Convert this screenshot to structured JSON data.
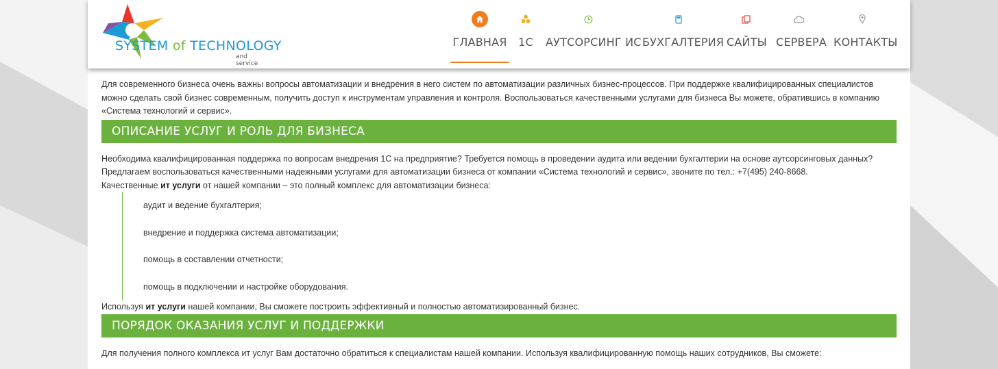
{
  "brand": {
    "logo_main": "SYSTEM",
    "logo_of": "of",
    "logo_tech": "TECHNOLOGY",
    "logo_sub": "and service"
  },
  "nav": {
    "items": [
      {
        "label": "ГЛАВНАЯ",
        "icon": "home-icon",
        "active": true
      },
      {
        "label": "1С",
        "icon": "radiation-icon"
      },
      {
        "label": "АУТСОРСИНГ ИС",
        "icon": "clock-icon"
      },
      {
        "label": "БУХГАЛТЕРИЯ",
        "icon": "calculator-icon"
      },
      {
        "label": "САЙТЫ",
        "icon": "copy-icon"
      },
      {
        "label": "СЕРВЕРА",
        "icon": "cloud-icon"
      },
      {
        "label": "КОНТАКТЫ",
        "icon": "map-pin-icon"
      }
    ],
    "accent": "#f07e1c"
  },
  "content": {
    "intro": "Для современного бизнеса очень важны вопросы автоматизации и внедрения в него систем по автоматизации различных бизнес-процессов. При поддержке квалифицированных специалистов можно сделать свой бизнес современным, получить доступ к инструментам управления и контроля. Воспользоваться качественными услугами для бизнеса Вы можете, обратившись в компанию «Система технологий и сервис».",
    "section1_title": "ОПИСАНИЕ УСЛУГ И РОЛЬ ДЛЯ БИЗНЕСА",
    "p1": "Необходима квалифицированная поддержка по вопросам внедрения 1С на предприятие? Требуется помощь в проведении аудита или ведении бухгалтерии на основе аутсорсинговых данных?",
    "p2": "Предлагаем воспользоваться качественными надежными услугами для автоматизации бизнеса от компании «Система технологий и сервис», звоните по тел.: +7(495) 240-8668.",
    "p3_before": "Качественные ",
    "p3_bold": "ит услуги",
    "p3_after": " от нашей компании – это полный комплекс для автоматизации бизнеса:",
    "list": [
      "аудит и ведение бухгалтерия;",
      "внедрение и поддержка система автоматизации;",
      "помощь в составлении отчетности;",
      "помощь в подключении и настройке оборудования."
    ],
    "p4_before": "Используя ",
    "p4_bold": "ит услуги",
    "p4_after": " нашей компании, Вы сможете построить эффективный и полностью автоматизированный бизнес.",
    "section2_title": "ПОРЯДОК ОКАЗАНИЯ УСЛУГ И ПОДДЕРЖКИ",
    "p5": "Для получения полного комплекса ит услуг Вам достаточно обратиться к специалистам нашей компании. Используя квалифицированную помощь наших сотрудников, Вы сможете:"
  },
  "colors": {
    "green": "#6ab23d",
    "orange": "#f07e1c",
    "blue": "#1e9ad6"
  }
}
